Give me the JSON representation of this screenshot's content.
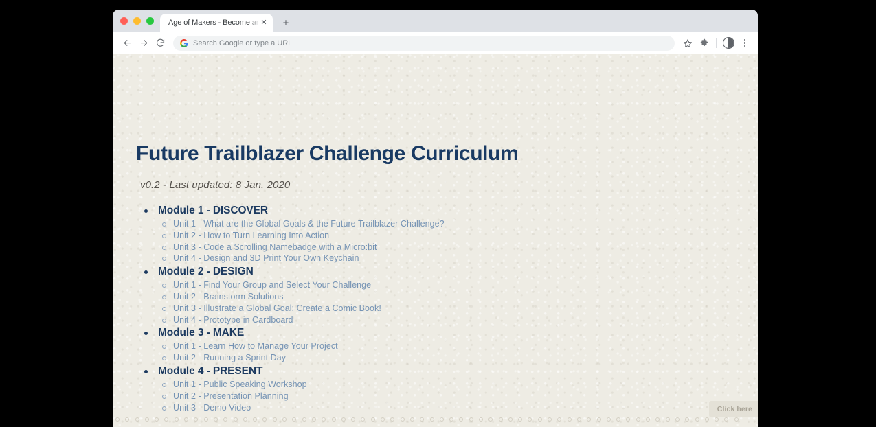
{
  "window": {
    "traffic_lights": [
      "close",
      "minimize",
      "zoom"
    ],
    "tab": {
      "title": "Age of Makers - Become an indepe",
      "close_label": "✕"
    },
    "new_tab_label": "+"
  },
  "toolbar": {
    "back_label": "Back",
    "forward_label": "Forward",
    "reload_label": "Reload",
    "omnibox_placeholder": "Search Google or type a URL",
    "omnibox_value": "",
    "bookmark_label": "Bookmark this tab",
    "extension_label": "Extensions",
    "profile_label": "Profile",
    "menu_label": "Customize and control Google Chrome"
  },
  "page": {
    "title": "Future Trailblazer Challenge Curriculum",
    "subtitle": "v0.2 - Last updated: 8 Jan. 2020",
    "modules": [
      {
        "heading": "Module 1 - DISCOVER",
        "units": [
          "Unit 1 - What are the Global Goals & the Future Trailblazer Challenge?",
          "Unit 2 - How to Turn Learning Into Action",
          "Unit 3 - Code a Scrolling Namebadge with a Micro:bit",
          "Unit 4 - Design and 3D Print Your Own Keychain"
        ]
      },
      {
        "heading": "Module 2 - DESIGN",
        "units": [
          "Unit 1 - Find Your Group and Select Your Challenge",
          "Unit 2 - Brainstorm Solutions",
          "Unit 3 - Illustrate a Global Goal: Create a Comic Book!",
          "Unit 4 - Prototype in Cardboard"
        ]
      },
      {
        "heading": "Module 3 - MAKE",
        "units": [
          "Unit 1 - Learn How to Manage Your Project",
          "Unit 2 - Running a Sprint Day"
        ]
      },
      {
        "heading": "Module 4 - PRESENT",
        "units": [
          "Unit 1 - Public Speaking Workshop",
          "Unit 2 - Presentation Planning",
          "Unit 3 - Demo Video"
        ]
      }
    ],
    "click_chip_label": "Click here"
  },
  "colors": {
    "paper": "#eeece4",
    "title_navy": "#193a63",
    "module_navy": "#1c3a60",
    "unit_blue": "#7593b4",
    "subtitle_gray": "#55514c",
    "chip_bg": "#e4e1d7",
    "chip_text": "#a9a497",
    "traffic_red": "#ff5f57",
    "traffic_yellow": "#febc2e",
    "traffic_green": "#28c840"
  }
}
